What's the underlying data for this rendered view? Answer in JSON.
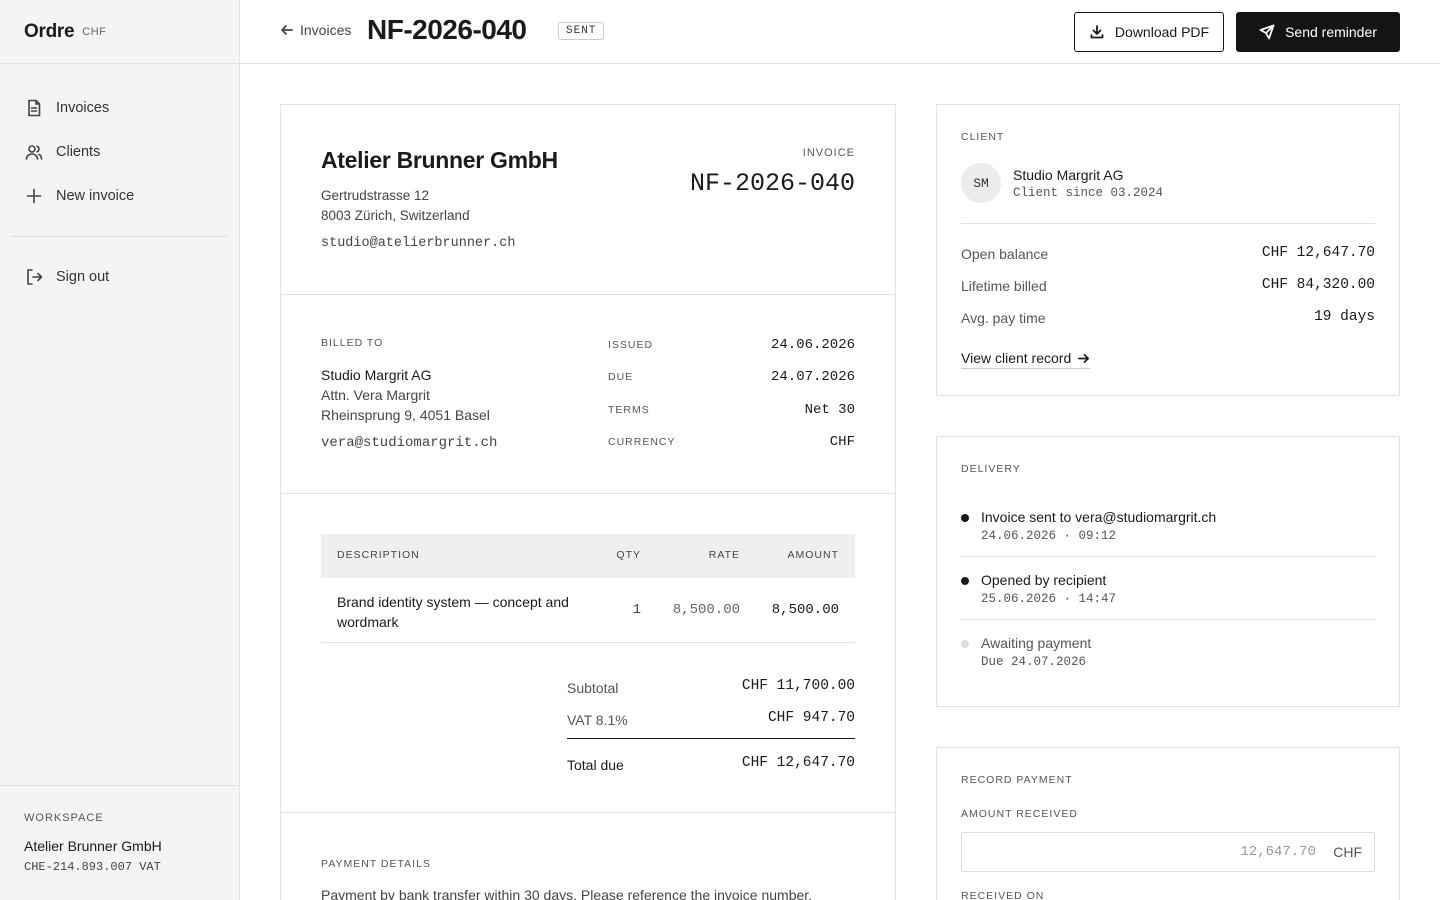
{
  "app": {
    "name": "Ordre",
    "currency": "CHF"
  },
  "sidebar": {
    "items": [
      {
        "label": "Invoices",
        "icon": "file-icon"
      },
      {
        "label": "Clients",
        "icon": "users-icon"
      },
      {
        "label": "New invoice",
        "icon": "plus-icon"
      }
    ],
    "signout": "Sign out",
    "workspace": {
      "label": "WORKSPACE",
      "name": "Atelier Brunner GmbH",
      "vat": "CHE-214.893.007 VAT"
    }
  },
  "header": {
    "back": "Invoices",
    "title": "NF-2026-040",
    "status": "SENT",
    "download": "Download PDF",
    "reminder": "Send reminder"
  },
  "invoice": {
    "from": {
      "name": "Atelier Brunner GmbH",
      "address1": "Gertrudstrasse 12",
      "address2": "8003 Zürich, Switzerland",
      "email": "studio@atelierbrunner.ch"
    },
    "label": "INVOICE",
    "number": "NF-2026-040",
    "billed_to": {
      "label": "BILLED TO",
      "name": "Studio Margrit AG",
      "attn": "Attn. Vera Margrit",
      "address": "Rheinsprung 9, 4051 Basel",
      "email": "vera@studiomargrit.ch"
    },
    "meta": [
      {
        "label": "ISSUED",
        "value": "24.06.2026"
      },
      {
        "label": "DUE",
        "value": "24.07.2026"
      },
      {
        "label": "TERMS",
        "value": "Net 30"
      },
      {
        "label": "CURRENCY",
        "value": "CHF"
      }
    ],
    "columns": {
      "description": "DESCRIPTION",
      "qty": "QTY",
      "rate": "RATE",
      "amount": "AMOUNT"
    },
    "items": [
      {
        "description": "Brand identity system — concept and wordmark",
        "qty": "1",
        "rate": "8,500.00",
        "amount": "8,500.00"
      }
    ],
    "totals": {
      "subtotal_label": "Subtotal",
      "subtotal": "CHF 11,700.00",
      "vat_label": "VAT 8.1%",
      "vat": "CHF 947.70",
      "total_label": "Total due",
      "total": "CHF 12,647.70"
    },
    "payment": {
      "label": "PAYMENT DETAILS",
      "text": "Payment by bank transfer within 30 days. Please reference the invoice number."
    }
  },
  "client_panel": {
    "label": "CLIENT",
    "initials": "SM",
    "name": "Studio Margrit AG",
    "since": "Client since 03.2024",
    "stats": [
      {
        "label": "Open balance",
        "value": "CHF 12,647.70"
      },
      {
        "label": "Lifetime billed",
        "value": "CHF 84,320.00"
      },
      {
        "label": "Avg. pay time",
        "value": "19 days"
      }
    ],
    "link": "View client record"
  },
  "delivery": {
    "label": "DELIVERY",
    "events": [
      {
        "title": "Invoice sent to vera@studiomargrit.ch",
        "sub": "24.06.2026 · 09:12",
        "done": true
      },
      {
        "title": "Opened by recipient",
        "sub": "25.06.2026 · 14:47",
        "done": true
      },
      {
        "title": "Awaiting payment",
        "sub": "Due 24.07.2026",
        "done": false
      }
    ]
  },
  "record_payment": {
    "label": "RECORD PAYMENT",
    "amount_label": "AMOUNT RECEIVED",
    "amount_placeholder": "12,647.70",
    "currency": "CHF",
    "received_label": "RECEIVED ON"
  }
}
